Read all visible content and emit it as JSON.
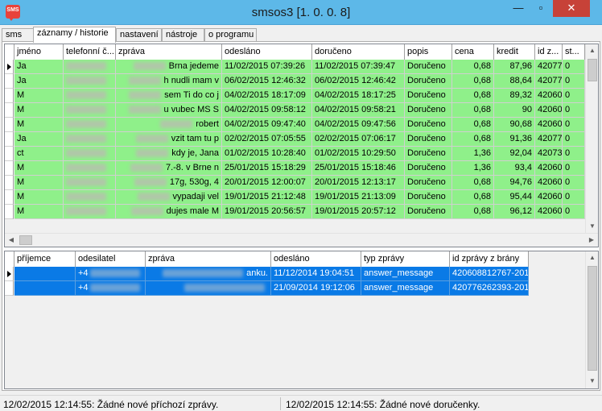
{
  "window": {
    "title": "smsos3 [1. 0. 0. 8]",
    "icon_label": "SMS",
    "minimize_icon": "—",
    "maximize_icon": "▫",
    "close_icon": "✕"
  },
  "tabs": [
    {
      "label": "sms"
    },
    {
      "label": "záznamy / historie",
      "active": true
    },
    {
      "label": "nastavení"
    },
    {
      "label": "nástroje"
    },
    {
      "label": "o programu"
    }
  ],
  "upper_table": {
    "columns": [
      "jméno",
      "telefonní č...",
      "zpráva",
      "odesláno",
      "doručeno",
      "popis",
      "cena",
      "kredit",
      "id z...",
      "st..."
    ],
    "rows": [
      {
        "name": "Ja",
        "phone": "",
        "msg": "Brna jedeme",
        "sent": "11/02/2015 07:39:26",
        "delivered": "11/02/2015 07:39:47",
        "status": "Doručeno",
        "price": "0,68",
        "credit": "87,96",
        "id": "42077",
        "st": "0"
      },
      {
        "name": "Ja",
        "phone": "",
        "msg": "h nudli mam v",
        "sent": "06/02/2015 12:46:32",
        "delivered": "06/02/2015 12:46:42",
        "status": "Doručeno",
        "price": "0,68",
        "credit": "88,64",
        "id": "42077",
        "st": "0"
      },
      {
        "name": "M",
        "phone": "",
        "msg": "sem Ti do co j",
        "sent": "04/02/2015 18:17:09",
        "delivered": "04/02/2015 18:17:25",
        "status": "Doručeno",
        "price": "0,68",
        "credit": "89,32",
        "id": "42060",
        "st": "0"
      },
      {
        "name": "M",
        "phone": "",
        "msg": "u vubec MS S",
        "sent": "04/02/2015 09:58:12",
        "delivered": "04/02/2015 09:58:21",
        "status": "Doručeno",
        "price": "0,68",
        "credit": "90",
        "id": "42060",
        "st": "0"
      },
      {
        "name": "M",
        "phone": "",
        "msg": "robert",
        "sent": "04/02/2015 09:47:40",
        "delivered": "04/02/2015 09:47:56",
        "status": "Doručeno",
        "price": "0,68",
        "credit": "90,68",
        "id": "42060",
        "st": "0"
      },
      {
        "name": "Ja",
        "phone": "",
        "msg": "vzit tam tu p",
        "sent": "02/02/2015 07:05:55",
        "delivered": "02/02/2015 07:06:17",
        "status": "Doručeno",
        "price": "0,68",
        "credit": "91,36",
        "id": "42077",
        "st": "0"
      },
      {
        "name": "ct",
        "phone": "",
        "msg": "kdy je, Jana",
        "sent": "01/02/2015 10:28:40",
        "delivered": "01/02/2015 10:29:50",
        "status": "Doručeno",
        "price": "1,36",
        "credit": "92,04",
        "id": "42073",
        "st": "0"
      },
      {
        "name": "M",
        "phone": "",
        "msg": "7.-8. v Brne n",
        "sent": "25/01/2015 15:18:29",
        "delivered": "25/01/2015 15:18:46",
        "status": "Doručeno",
        "price": "1,36",
        "credit": "93,4",
        "id": "42060",
        "st": "0"
      },
      {
        "name": "M",
        "phone": "",
        "msg": "17g, 530g, 4",
        "sent": "20/01/2015 12:00:07",
        "delivered": "20/01/2015 12:13:17",
        "status": "Doručeno",
        "price": "0,68",
        "credit": "94,76",
        "id": "42060",
        "st": "0"
      },
      {
        "name": "M",
        "phone": "",
        "msg": "vypadaji vel",
        "sent": "19/01/2015 21:12:48",
        "delivered": "19/01/2015 21:13:09",
        "status": "Doručeno",
        "price": "0,68",
        "credit": "95,44",
        "id": "42060",
        "st": "0"
      },
      {
        "name": "M",
        "phone": "",
        "msg": "dujes male M",
        "sent": "19/01/2015 20:56:57",
        "delivered": "19/01/2015 20:57:12",
        "status": "Doručeno",
        "price": "0,68",
        "credit": "96,12",
        "id": "42060",
        "st": "0"
      }
    ]
  },
  "lower_table": {
    "columns": [
      "příjemce",
      "odesilatel",
      "zpráva",
      "odesláno",
      "typ zprávy",
      "id zprávy z brány"
    ],
    "rows": [
      {
        "recipient": "",
        "sender": "+4",
        "msg": "anku.",
        "sent": "11/12/2014 19:04:51",
        "type": "answer_message",
        "gw_id": "420608812767-201"
      },
      {
        "recipient": "",
        "sender": "+4",
        "msg": "",
        "sent": "21/09/2014 19:12:06",
        "type": "answer_message",
        "gw_id": "420776262393-201"
      }
    ]
  },
  "statusbar": {
    "left": "12/02/2015 12:14:55: Žádné nové příchozí zprávy.",
    "right": "12/02/2015 12:14:55: Žádné nové doručenky."
  },
  "icons": {
    "row_pointer": "pointer-arrow-icon",
    "scroll_up": "▲",
    "scroll_down": "▼",
    "scroll_left": "◀",
    "scroll_right": "▶"
  },
  "colors": {
    "titlebar": "#5db8e8",
    "row_delivered": "#8ff08a",
    "row_selected": "#0a7ae6",
    "close_button": "#c74238"
  }
}
